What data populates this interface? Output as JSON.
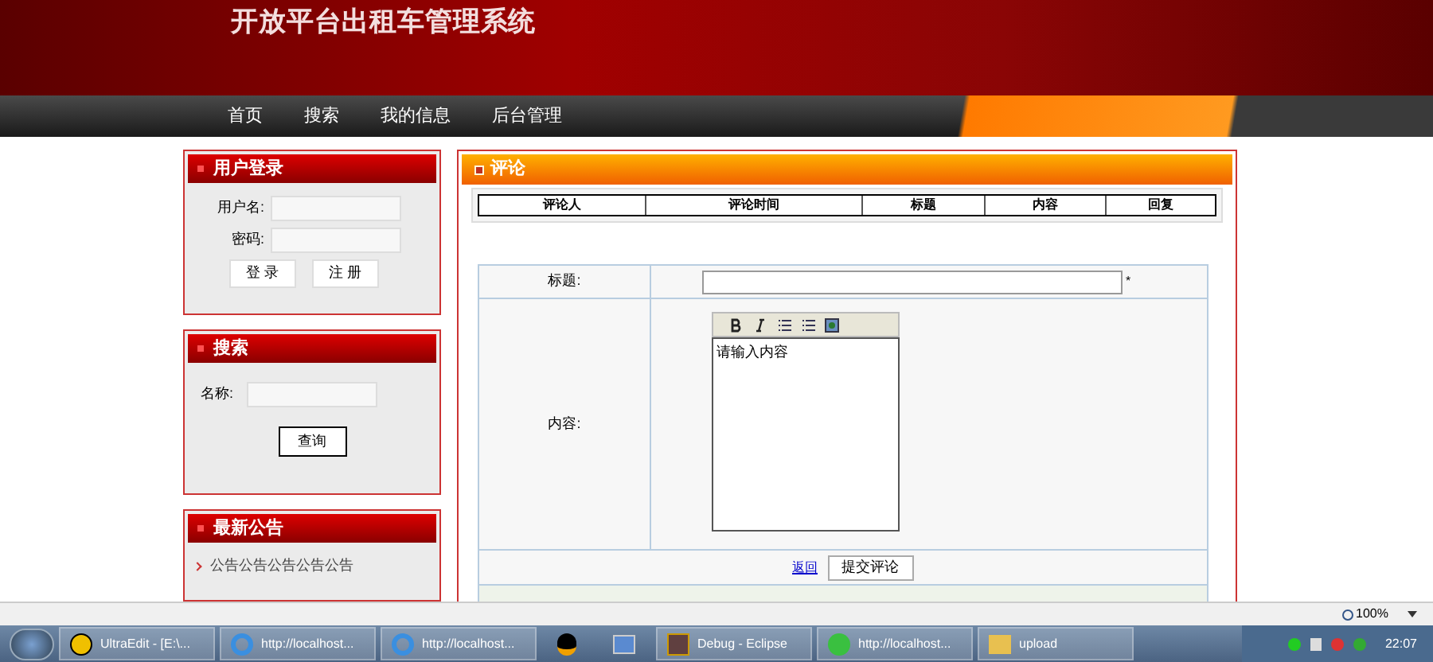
{
  "header": {
    "title": "开放平台出租车管理系统"
  },
  "nav": [
    {
      "label": "首页"
    },
    {
      "label": "搜索"
    },
    {
      "label": "我的信息"
    },
    {
      "label": "后台管理"
    }
  ],
  "login": {
    "title": "用户登录",
    "fields": [
      {
        "label": "用户名:"
      },
      {
        "label": "密码:"
      }
    ],
    "buttons": [
      "登 录",
      "注 册"
    ]
  },
  "search": {
    "title": "搜索",
    "field_label": "名称:",
    "button": "查询"
  },
  "notices": {
    "title": "最新公告",
    "items": [
      "公告公告公告公告公告"
    ]
  },
  "comments": {
    "title": "评论",
    "columns": [
      "评论人",
      "评论时间",
      "标题",
      "内容",
      "回复"
    ]
  },
  "form": {
    "title_label": "标题:",
    "content_label": "内容:",
    "content_placeholder": "请输入内容",
    "required_mark": "*",
    "back_link": "返回",
    "submit": "提交评论"
  },
  "status_bar": {
    "zoom": "100%"
  },
  "taskbar": {
    "items": [
      {
        "kind": "ue",
        "label": "UltraEdit - [E:\\..."
      },
      {
        "kind": "ie",
        "label": "http://localhost..."
      },
      {
        "kind": "ie",
        "label": "http://localhost..."
      },
      {
        "kind": "qq"
      },
      {
        "kind": "net"
      },
      {
        "kind": "eclipse",
        "label": "Debug - Eclipse"
      },
      {
        "kind": "ie2",
        "label": "http://localhost..."
      },
      {
        "kind": "folder",
        "label": "upload"
      }
    ],
    "clock": "22:07"
  }
}
